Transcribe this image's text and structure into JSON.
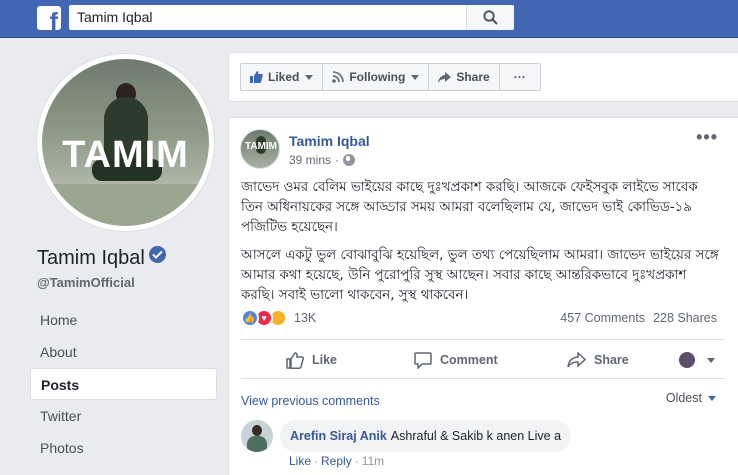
{
  "search": {
    "query": "Tamim Iqbal"
  },
  "profile": {
    "picture_text": "TAMIM",
    "name": "Tamim Iqbal",
    "handle": "@TamimOfficial"
  },
  "nav": {
    "items": [
      {
        "label": "Home",
        "active": false
      },
      {
        "label": "About",
        "active": false
      },
      {
        "label": "Posts",
        "active": true
      },
      {
        "label": "Twitter",
        "active": false
      },
      {
        "label": "Photos",
        "active": false
      }
    ]
  },
  "actions": {
    "liked_label": "Liked",
    "following_label": "Following",
    "share_label": "Share",
    "more_label": "···"
  },
  "post": {
    "avatar_text": "TAMIM",
    "author": "Tamim Iqbal",
    "time": "39 mins",
    "more_label": "•••",
    "paragraph1": "জাভেদ ওমর বেলিম ভাইয়ের কাছে দুঃখপ্রকাশ করছি। আজকে ফেইসবুক লাইভে সাবেক তিন অধিনায়কের সঙ্গে আড্ডার সময় আমরা বলেছিলাম যে, জাভেদ ভাই কোভিড-১৯ পজিটিভ হয়েছেন।",
    "paragraph2": "আসলে একটু ভুল বোঝাবুঝি হয়েছিল, ভুল তথ্য পেয়েছিলাম আমরা। জাভেদ ভাইয়ের সঙ্গে আমার কথা হয়েছে, উনি পুরোপুরি সুস্থ আছেন। সবার কাছে আন্তরিকভাবে দুঃখপ্রকাশ করছি। সবাই ভালো থাকবেন, সুস্থ থাকবেন।",
    "reaction_count": "13K",
    "comments_count": "457 Comments",
    "shares_count": "228 Shares",
    "like_label": "Like",
    "comment_label": "Comment",
    "share_label": "Share"
  },
  "comments": {
    "view_previous": "View previous comments",
    "sort_label": "Oldest",
    "items": [
      {
        "author": "Arefin Siraj Anik",
        "text": "Ashraful & Sakib k anen Live a",
        "like_label": "Like",
        "reply_label": "Reply",
        "time": "11m"
      }
    ]
  },
  "colors": {
    "brand": "#4267b2",
    "link": "#365899",
    "background": "#e9ebee"
  }
}
